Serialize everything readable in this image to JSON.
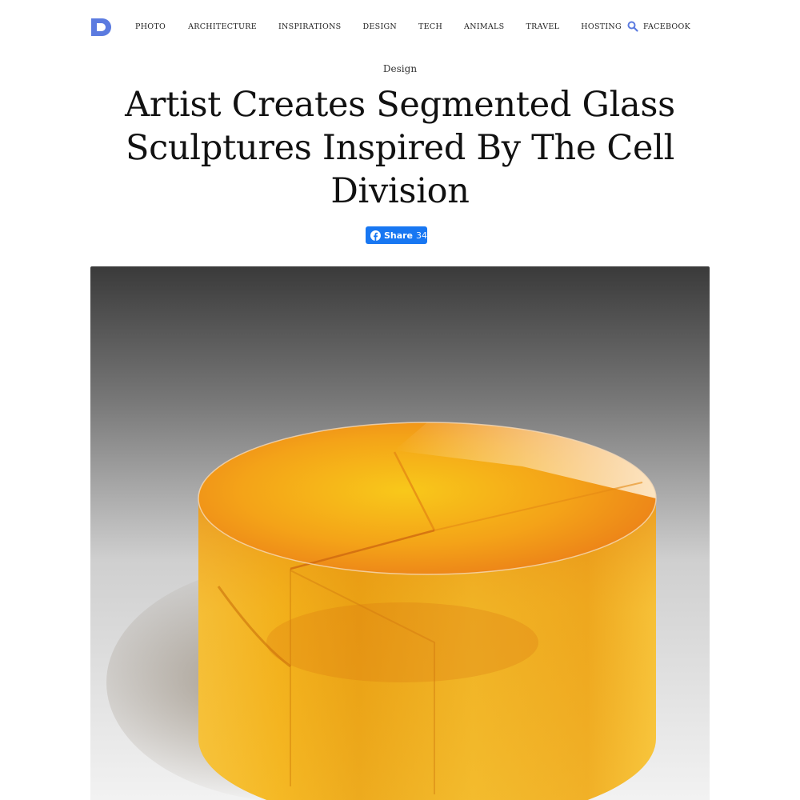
{
  "nav": {
    "items": [
      {
        "label": "PHOTO"
      },
      {
        "label": "ARCHITECTURE"
      },
      {
        "label": "INSPIRATIONS"
      },
      {
        "label": "DESIGN"
      },
      {
        "label": "TECH"
      },
      {
        "label": "ANIMALS"
      },
      {
        "label": "TRAVEL"
      },
      {
        "label": "HOSTING"
      },
      {
        "label": "FACEBOOK"
      }
    ],
    "logo_letter": "D",
    "logo_color": "#5b7be0",
    "search_icon": "search-icon"
  },
  "article": {
    "category": "Design",
    "title": "Artist Creates Segmented Glass Sculptures Inspired By The Cell Division"
  },
  "share": {
    "label": "Share",
    "count": "34",
    "color": "#1877f2",
    "icon": "facebook-icon"
  }
}
